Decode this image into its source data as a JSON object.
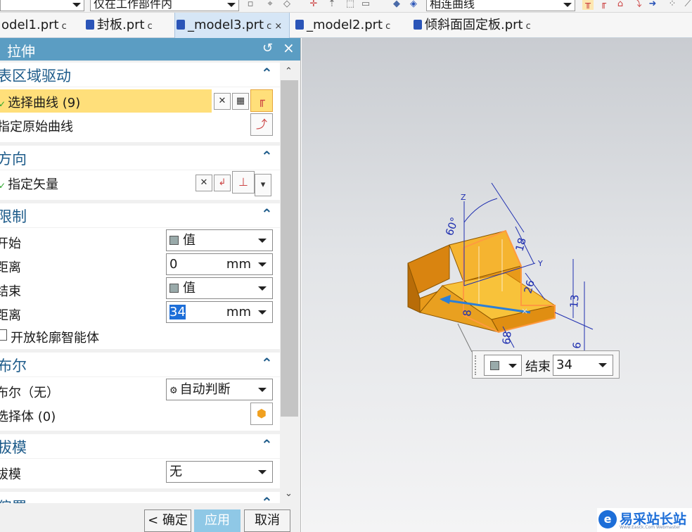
{
  "toolbar": {
    "filter_select": "仅在工作部件内",
    "curve_rule_select": "相连曲线",
    "icons": [
      "selection-filter-icon",
      "snap-icon",
      "point-icon",
      "box-select-icon",
      "solid-icon",
      "curve-rule-icon",
      "stop-at-intersection-icon",
      "follow-fillet-icon",
      "chain-icon",
      "path-icon",
      "more-icon"
    ]
  },
  "tabs": [
    {
      "label": "odel1.prt",
      "mark": "ᴄ",
      "active": false
    },
    {
      "label": "封板.prt",
      "mark": "ᴄ",
      "active": false
    },
    {
      "label": "_model3.prt",
      "mark": "ᴄ ×",
      "active": true
    },
    {
      "label": "_model2.prt",
      "mark": "ᴄ",
      "active": false
    },
    {
      "label": "倾斜面固定板.prt",
      "mark": "ᴄ",
      "active": false
    }
  ],
  "dialog": {
    "title": "拉伸",
    "reset_icon": "↺",
    "close_icon": "×",
    "sections": {
      "section_drive": {
        "title": "表区域驱动",
        "select_curve": "选择曲线 (9)",
        "specify_original": "指定原始曲线"
      },
      "direction": {
        "title": "方向",
        "specify_vector": "指定矢量"
      },
      "limits": {
        "title": "限制",
        "start_label": "开始",
        "start_value": "值",
        "start_distance_label": "距离",
        "start_distance": "0",
        "end_label": "结束",
        "end_value": "值",
        "end_distance_label": "距离",
        "end_distance": "34",
        "unit": "mm",
        "open_profile": "开放轮廓智能体"
      },
      "boolean": {
        "title": "布尔",
        "boolean_label": "布尔（无）",
        "boolean_value": "自动判断",
        "select_body": "选择体 (0)"
      },
      "draft": {
        "title": "拔模",
        "draft_label": "拔模",
        "draft_value": "无"
      },
      "offset": {
        "title": "偏置"
      }
    },
    "buttons": {
      "ok": "< 确定 >",
      "apply": "应用",
      "cancel": "取消"
    }
  },
  "viewport": {
    "onscreen_label": "结束",
    "onscreen_value": "34",
    "dimensions": [
      "60°",
      "18",
      "26",
      "13",
      "8",
      "6",
      "68"
    ],
    "axes": [
      "Z",
      "Y"
    ]
  },
  "watermark": {
    "brand": "易采站长站",
    "sub": "Www.Easck.Com  Webmaster"
  },
  "colors": {
    "dialog_title_bg": "#5b9dc3",
    "section_title": "#1d5b8a",
    "highlight_row": "#ffdf7a",
    "model_fill": "#f3a21a",
    "dimension_blue": "#1f2fb0"
  }
}
